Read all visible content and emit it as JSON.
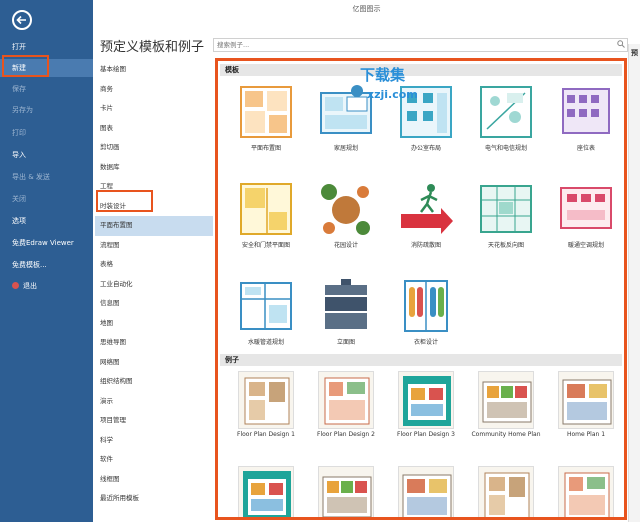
{
  "window": {
    "title": "亿图图示"
  },
  "sidebar": {
    "items": [
      {
        "label": "打开",
        "state": "normal"
      },
      {
        "label": "新建",
        "state": "active"
      },
      {
        "label": "保存",
        "state": "dim"
      },
      {
        "label": "另存为",
        "state": "dim"
      },
      {
        "label": "打印",
        "state": "dim"
      },
      {
        "label": "导入",
        "state": "normal"
      },
      {
        "label": "导出 & 发送",
        "state": "dim"
      },
      {
        "label": "关闭",
        "state": "dim"
      },
      {
        "label": "选项",
        "state": "normal"
      },
      {
        "label": "免费Edraw Viewer",
        "state": "normal"
      },
      {
        "label": "免费模板...",
        "state": "normal"
      },
      {
        "label": "退出",
        "state": "normal"
      }
    ]
  },
  "main": {
    "heading": "预定义模板和例子",
    "search_placeholder": "搜索例子..."
  },
  "categories": [
    "基本绘图",
    "商务",
    "卡片",
    "图表",
    "剪切画",
    "数据库",
    "工程",
    "时装设计",
    "平面布置图",
    "流程图",
    "表格",
    "工业自动化",
    "信息图",
    "地图",
    "思维导图",
    "网络图",
    "组织结构图",
    "演示",
    "项目管理",
    "科学",
    "软件",
    "线框图",
    "最近所用模板"
  ],
  "selected_category": "平面布置图",
  "templates": {
    "header": "模板",
    "items": [
      "平面布置图",
      "家居规划",
      "办公室布局",
      "电气和电信规划",
      "座位表",
      "安全和门禁平面图",
      "花园设计",
      "消防疏散图",
      "天花板反向图",
      "暖通空调规划",
      "水暖管道规划",
      "立面图",
      "衣柜设计"
    ]
  },
  "examples": {
    "header": "例子",
    "items": [
      "Floor Plan Design 1",
      "Floor Plan Design 2",
      "Floor Plan Design 3",
      "Community Home Plan",
      "Home Plan 1"
    ]
  },
  "watermark": {
    "title": "下载集",
    "subtitle": "xzji.com"
  },
  "right_panel_label": "预",
  "colors": {
    "sidebar": "#2d5e93",
    "highlight": "#e8541e",
    "selected": "#c8dcef"
  }
}
